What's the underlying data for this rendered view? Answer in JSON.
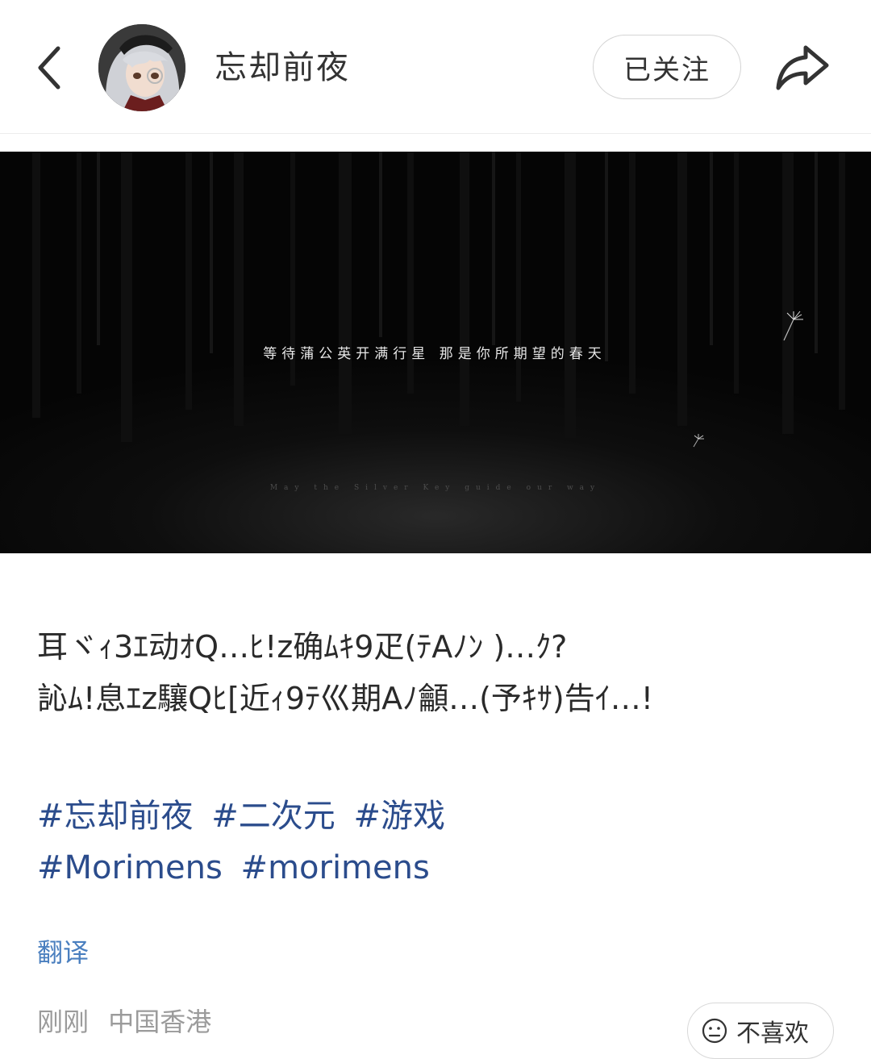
{
  "header": {
    "username": "忘却前夜",
    "follow_label": "已关注"
  },
  "media": {
    "caption": "等待蒲公英开满行星  那是你所期望的春天",
    "subcaption": "May the Silver Key guide our way"
  },
  "post": {
    "lines": [
      "耳ヾｨ3ｴ动ｵQ…ﾋ!z确ﾑｷ9疋(ﾃAﾉﾝ )…ｸ?",
      "訫ﾑ!息ｴz驤Qﾋ[近ｨ9ﾃ巛期Aﾉ龥…(予ｷｻ)告ｲ…!"
    ],
    "tags_line1": [
      "#忘却前夜",
      "#二次元",
      "#游戏"
    ],
    "tags_line2": [
      "#Morimens",
      "#morimens"
    ],
    "translate_label": "翻译",
    "time": "刚刚",
    "location": "中国香港",
    "dislike_label": "不喜欢"
  },
  "icons": {
    "back": "back-arrow-icon",
    "share": "share-icon",
    "dislike": "sad-face-icon"
  },
  "colors": {
    "tag": "#2b4c8c",
    "link": "#4a7fbf",
    "meta": "#9b9b9b"
  }
}
